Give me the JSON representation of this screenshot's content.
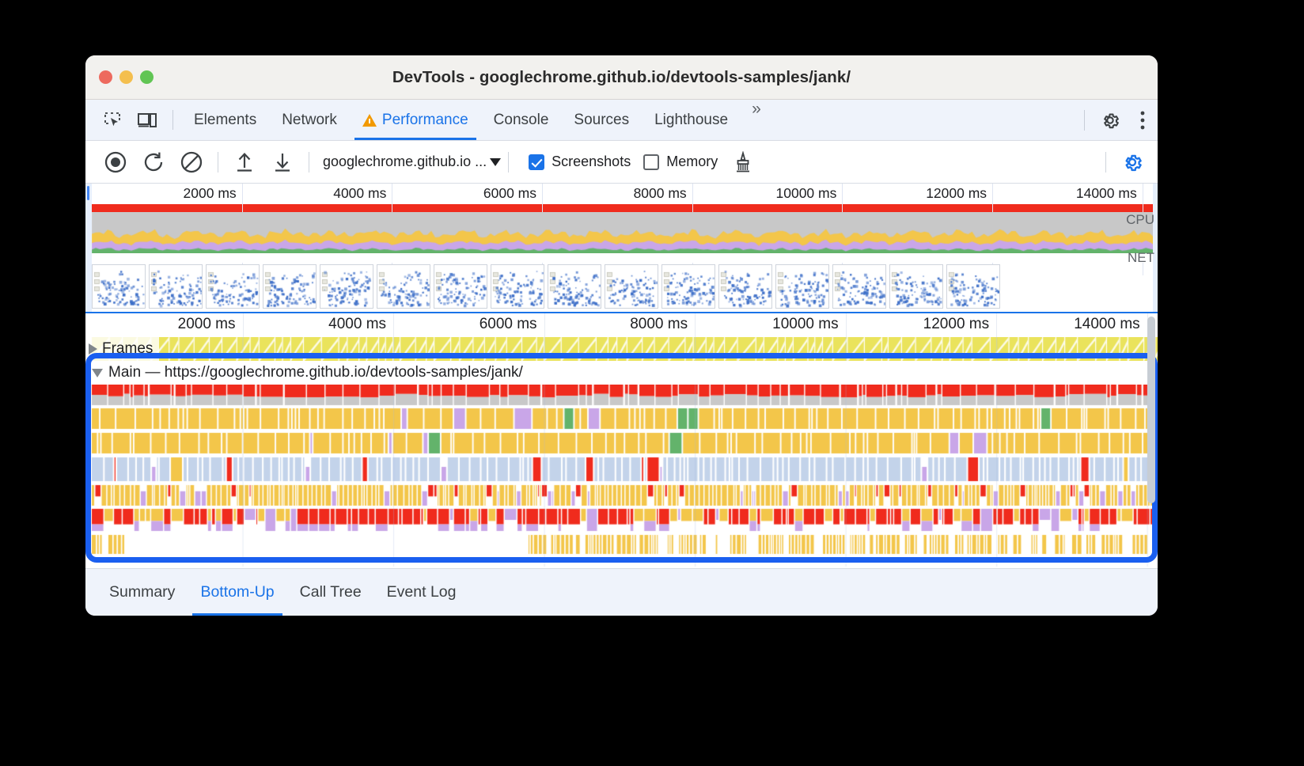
{
  "window": {
    "title": "DevTools - googlechrome.github.io/devtools-samples/jank/",
    "traffic_lights": [
      "close",
      "minimize",
      "maximize"
    ]
  },
  "tabbar": {
    "icons": [
      {
        "name": "inspect-element-icon",
        "glyph": "inspect"
      },
      {
        "name": "device-toolbar-icon",
        "glyph": "device"
      }
    ],
    "tabs": [
      {
        "label": "Elements",
        "active": false,
        "warning": false
      },
      {
        "label": "Network",
        "active": false,
        "warning": false
      },
      {
        "label": "Performance",
        "active": true,
        "warning": true
      },
      {
        "label": "Console",
        "active": false,
        "warning": false
      },
      {
        "label": "Sources",
        "active": false,
        "warning": false
      },
      {
        "label": "Lighthouse",
        "active": false,
        "warning": false
      }
    ],
    "more_tabs_label": "»",
    "settings_icon": "gear-icon",
    "more_options_icon": "kebab-menu-icon"
  },
  "perf_toolbar": {
    "record_label": "Record",
    "reload_label": "Start profiling and reload page",
    "clear_label": "Clear",
    "load_label": "Load profile",
    "save_label": "Save profile",
    "url_selector_value": "googlechrome.github.io ...",
    "screenshots": {
      "label": "Screenshots",
      "checked": true
    },
    "memory": {
      "label": "Memory",
      "checked": false
    },
    "garbage_collect_label": "Collect garbage",
    "capture_settings_label": "Capture settings"
  },
  "overview": {
    "ticks": [
      "2000 ms",
      "4000 ms",
      "6000 ms",
      "8000 ms",
      "10000 ms",
      "12000 ms",
      "14000 ms"
    ],
    "cpu_label": "CPU",
    "net_label": "NET",
    "filmstrip_frames": 16
  },
  "flame": {
    "ticks": [
      "2000 ms",
      "4000 ms",
      "6000 ms",
      "8000 ms",
      "10000 ms",
      "12000 ms",
      "14000 ms"
    ],
    "frames_track_label": "Frames",
    "main_track_label": "Main — https://googlechrome.github.io/devtools-samples/jank/",
    "highlighted": true
  },
  "bottom_tabs": [
    {
      "label": "Summary",
      "active": false
    },
    {
      "label": "Bottom-Up",
      "active": true
    },
    {
      "label": "Call Tree",
      "active": false
    },
    {
      "label": "Event Log",
      "active": false
    }
  ],
  "colors": {
    "accent": "#1a73e8",
    "highlight_box": "#1a5ff0",
    "warning": "#f29900",
    "scripting_yellow": "#f3c64a",
    "rendering_purple": "#c9a6e8",
    "painting_green": "#63b36b",
    "loading_blue": "#c3d3ea",
    "red_marker": "#f02b1d",
    "idle_gray": "#c8c8c8",
    "frames_yellow": "#eae35c"
  }
}
